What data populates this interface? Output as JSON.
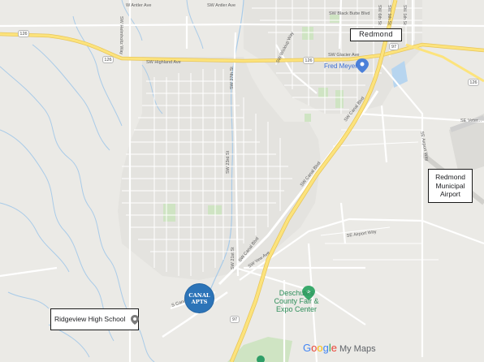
{
  "map": {
    "streets": {
      "antler_w": "W Antler Ave",
      "antler_sw": "SW Antler Ave",
      "helmholtz": "SW Helmholtz Way",
      "highland": "SW Highland Ave",
      "glacier": "SW Glacier Ave",
      "black_butte": "SW Black Butte Blvd",
      "st_5": "SW 5th St",
      "st_6": "SW 6th St",
      "st_9": "SW 9th St",
      "st_27": "SW 27th St",
      "st_23": "SW 23rd St",
      "st_21": "SW 21st St",
      "wickiup": "SW Wickiup Way",
      "canal_blvd": "SW Canal Blvd",
      "yew": "SW Yew Ave",
      "airport_way": "SE Airport Way",
      "veterans": "SE Veter...",
      "s_canal": "S Canal"
    },
    "shields": {
      "r126_west": "126",
      "r126_mid": "126",
      "r126_east": "126",
      "r97_north": "97",
      "r97_south": "97"
    },
    "places": {
      "fred_meyer": "Fred Meyer",
      "fair": "Deschutes County Fair & Expo Center"
    },
    "highlighted": {
      "redmond": "Redmond",
      "airport_lines": [
        "Redmond",
        "Municipal",
        "Airport"
      ],
      "school": "Ridgeview High School"
    },
    "marker": {
      "lines": [
        "CANAL",
        "APTS"
      ]
    },
    "branding": {
      "google_letters": [
        "G",
        "o",
        "o",
        "g",
        "l",
        "e"
      ],
      "google_colors": [
        "#4285F4",
        "#EA4335",
        "#FBBC05",
        "#4285F4",
        "#34A853",
        "#EA4335"
      ],
      "product": "My Maps"
    },
    "colors": {
      "background": "#ebeae6",
      "highway": "#fce37c",
      "marker": "#2c74b8",
      "water": "#9dc6e8",
      "park": "#c9e1bd"
    }
  }
}
